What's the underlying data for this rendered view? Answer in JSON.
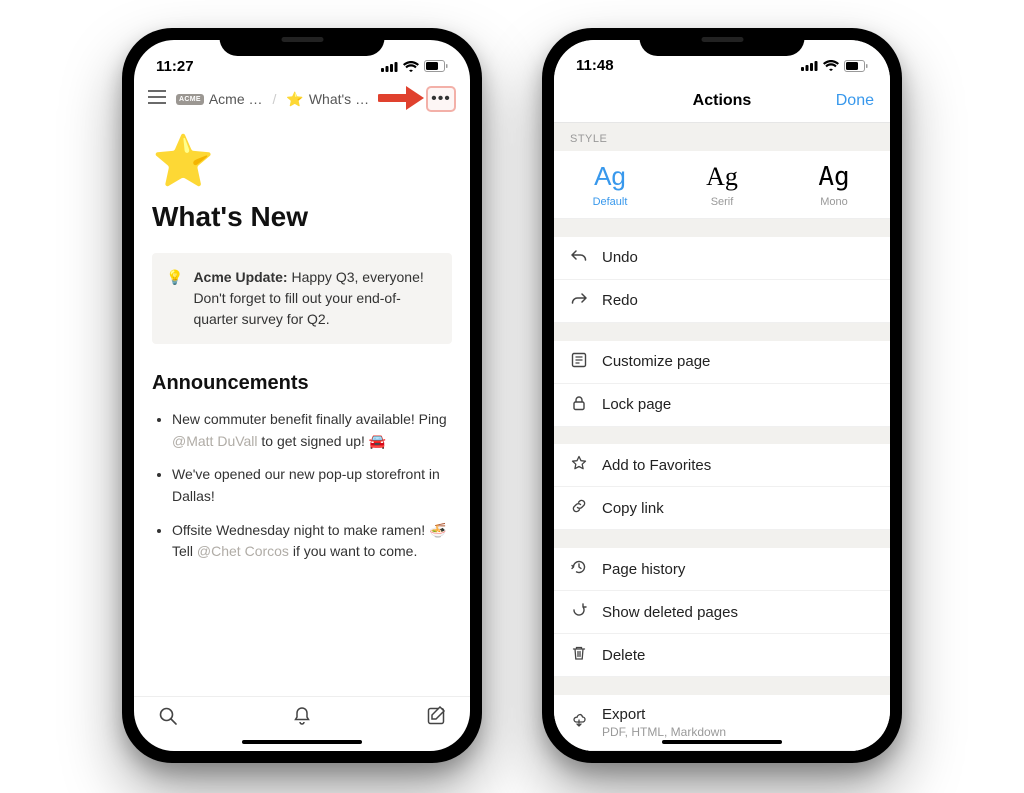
{
  "left": {
    "status_time": "11:27",
    "breadcrumb": {
      "workspace": "Acme …",
      "page": "What's …"
    },
    "page_icon": "⭐",
    "page_title": "What's New",
    "callout": {
      "icon": "💡",
      "bold": "Acme Update:",
      "text": " Happy Q3, everyone! Don't forget to fill out your end-of-quarter survey for Q2."
    },
    "announcements_heading": "Announcements",
    "announcements": [
      {
        "pre": "New commuter benefit finally available! Ping ",
        "mention": "@Matt DuVall",
        "post": " to get signed up! 🚘"
      },
      {
        "pre": "We've opened our new pop-up storefront in Dallas!",
        "mention": "",
        "post": ""
      },
      {
        "pre": "Offsite Wednesday night to make ramen! 🍜 Tell ",
        "mention": "@Chet Corcos",
        "post": " if you want to come."
      }
    ]
  },
  "right": {
    "status_time": "11:48",
    "header_title": "Actions",
    "done_label": "Done",
    "style_label": "Style",
    "styles": [
      {
        "sample": "Ag",
        "label": "Default",
        "selected": true
      },
      {
        "sample": "Ag",
        "label": "Serif",
        "selected": false
      },
      {
        "sample": "Ag",
        "label": "Mono",
        "selected": false
      }
    ],
    "group1": [
      {
        "icon": "undo",
        "label": "Undo"
      },
      {
        "icon": "redo",
        "label": "Redo"
      }
    ],
    "group2": [
      {
        "icon": "customize",
        "label": "Customize page"
      },
      {
        "icon": "lock",
        "label": "Lock page"
      }
    ],
    "group3": [
      {
        "icon": "star",
        "label": "Add to Favorites"
      },
      {
        "icon": "link",
        "label": "Copy link"
      }
    ],
    "group4": [
      {
        "icon": "history",
        "label": "Page history"
      },
      {
        "icon": "trash-restore",
        "label": "Show deleted pages"
      },
      {
        "icon": "delete",
        "label": "Delete"
      }
    ],
    "group5": [
      {
        "icon": "export",
        "label": "Export",
        "sub": "PDF, HTML, Markdown"
      }
    ]
  }
}
